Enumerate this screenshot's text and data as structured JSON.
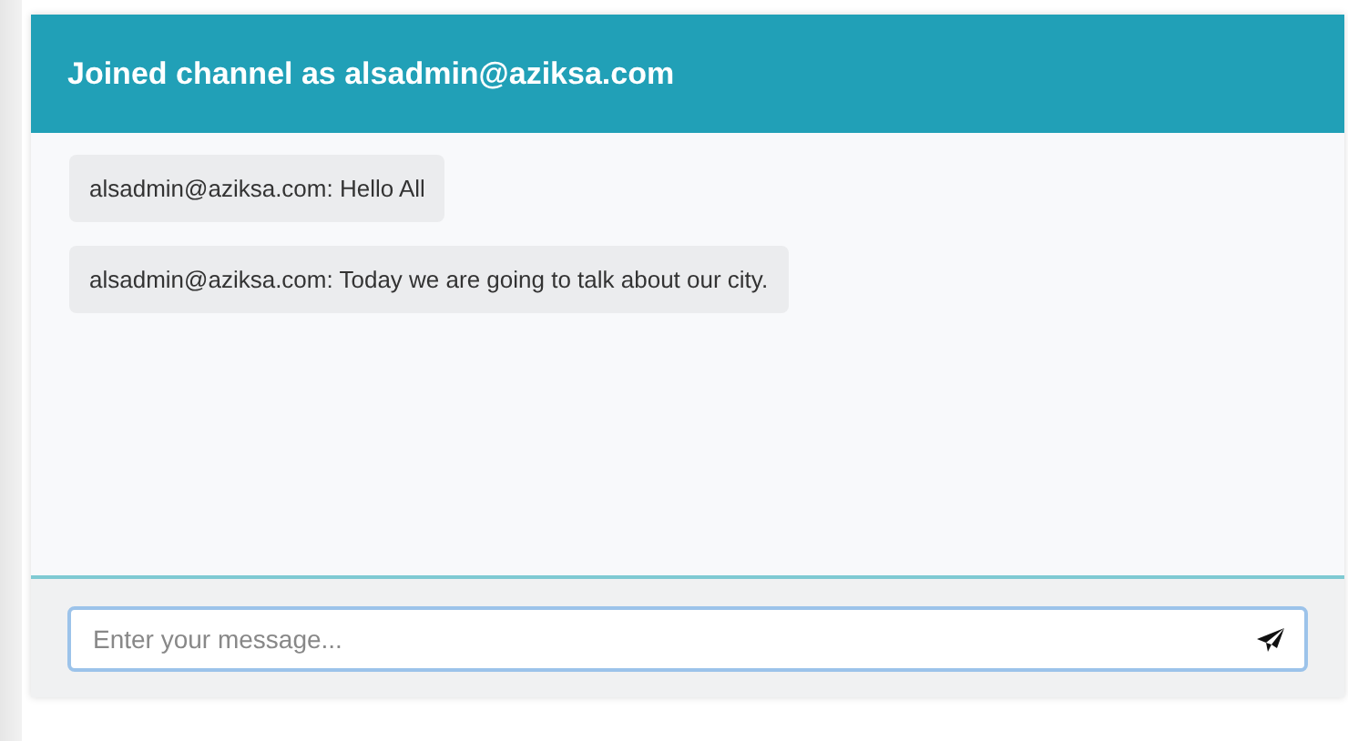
{
  "header": {
    "title": "Joined channel as alsadmin@aziksa.com"
  },
  "messages": [
    {
      "text": "alsadmin@aziksa.com: Hello All"
    },
    {
      "text": "alsadmin@aziksa.com: Today we are going to talk about our city."
    }
  ],
  "composer": {
    "placeholder": "Enter your message..."
  }
}
